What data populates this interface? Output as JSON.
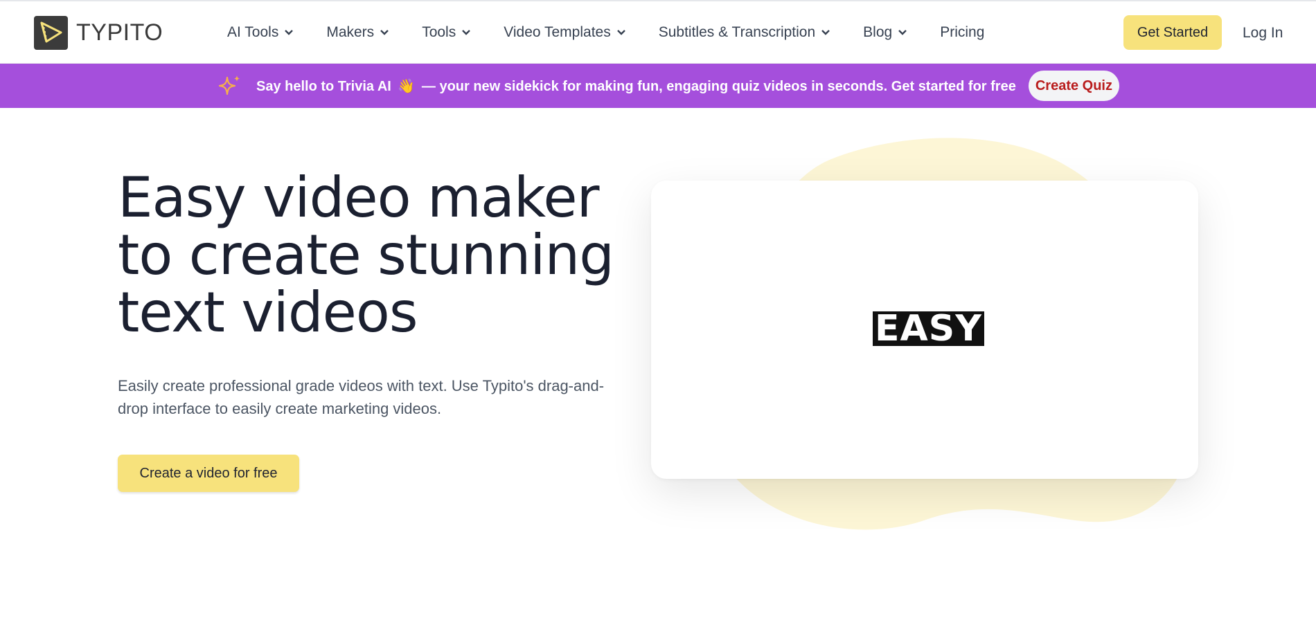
{
  "brand": {
    "name": "TYPITO"
  },
  "nav": {
    "items": [
      {
        "label": "AI Tools",
        "has_dropdown": true
      },
      {
        "label": "Makers",
        "has_dropdown": true
      },
      {
        "label": "Tools",
        "has_dropdown": true
      },
      {
        "label": "Video Templates",
        "has_dropdown": true
      },
      {
        "label": "Subtitles & Transcription",
        "has_dropdown": true
      },
      {
        "label": "Blog",
        "has_dropdown": true
      },
      {
        "label": "Pricing",
        "has_dropdown": false
      }
    ],
    "cta_label": "Get Started",
    "login_label": "Log In"
  },
  "banner": {
    "text_before": "Say hello to Trivia AI",
    "emoji": "👋",
    "text_after": "— your new sidekick for making fun, engaging quiz videos in seconds. Get started for free",
    "button_label": "Create Quiz",
    "background": "#a54fdc"
  },
  "hero": {
    "title_highlight": "Easy video maker",
    "title_line2": "to create stunning",
    "title_line3": "text videos",
    "description": "Easily create professional grade videos with text. Use Typito's drag-and-drop interface to easily create marketing videos.",
    "cta_label": "Create a video for free",
    "accent": "#f7e27c"
  },
  "video_preview": {
    "word": "EASY"
  }
}
